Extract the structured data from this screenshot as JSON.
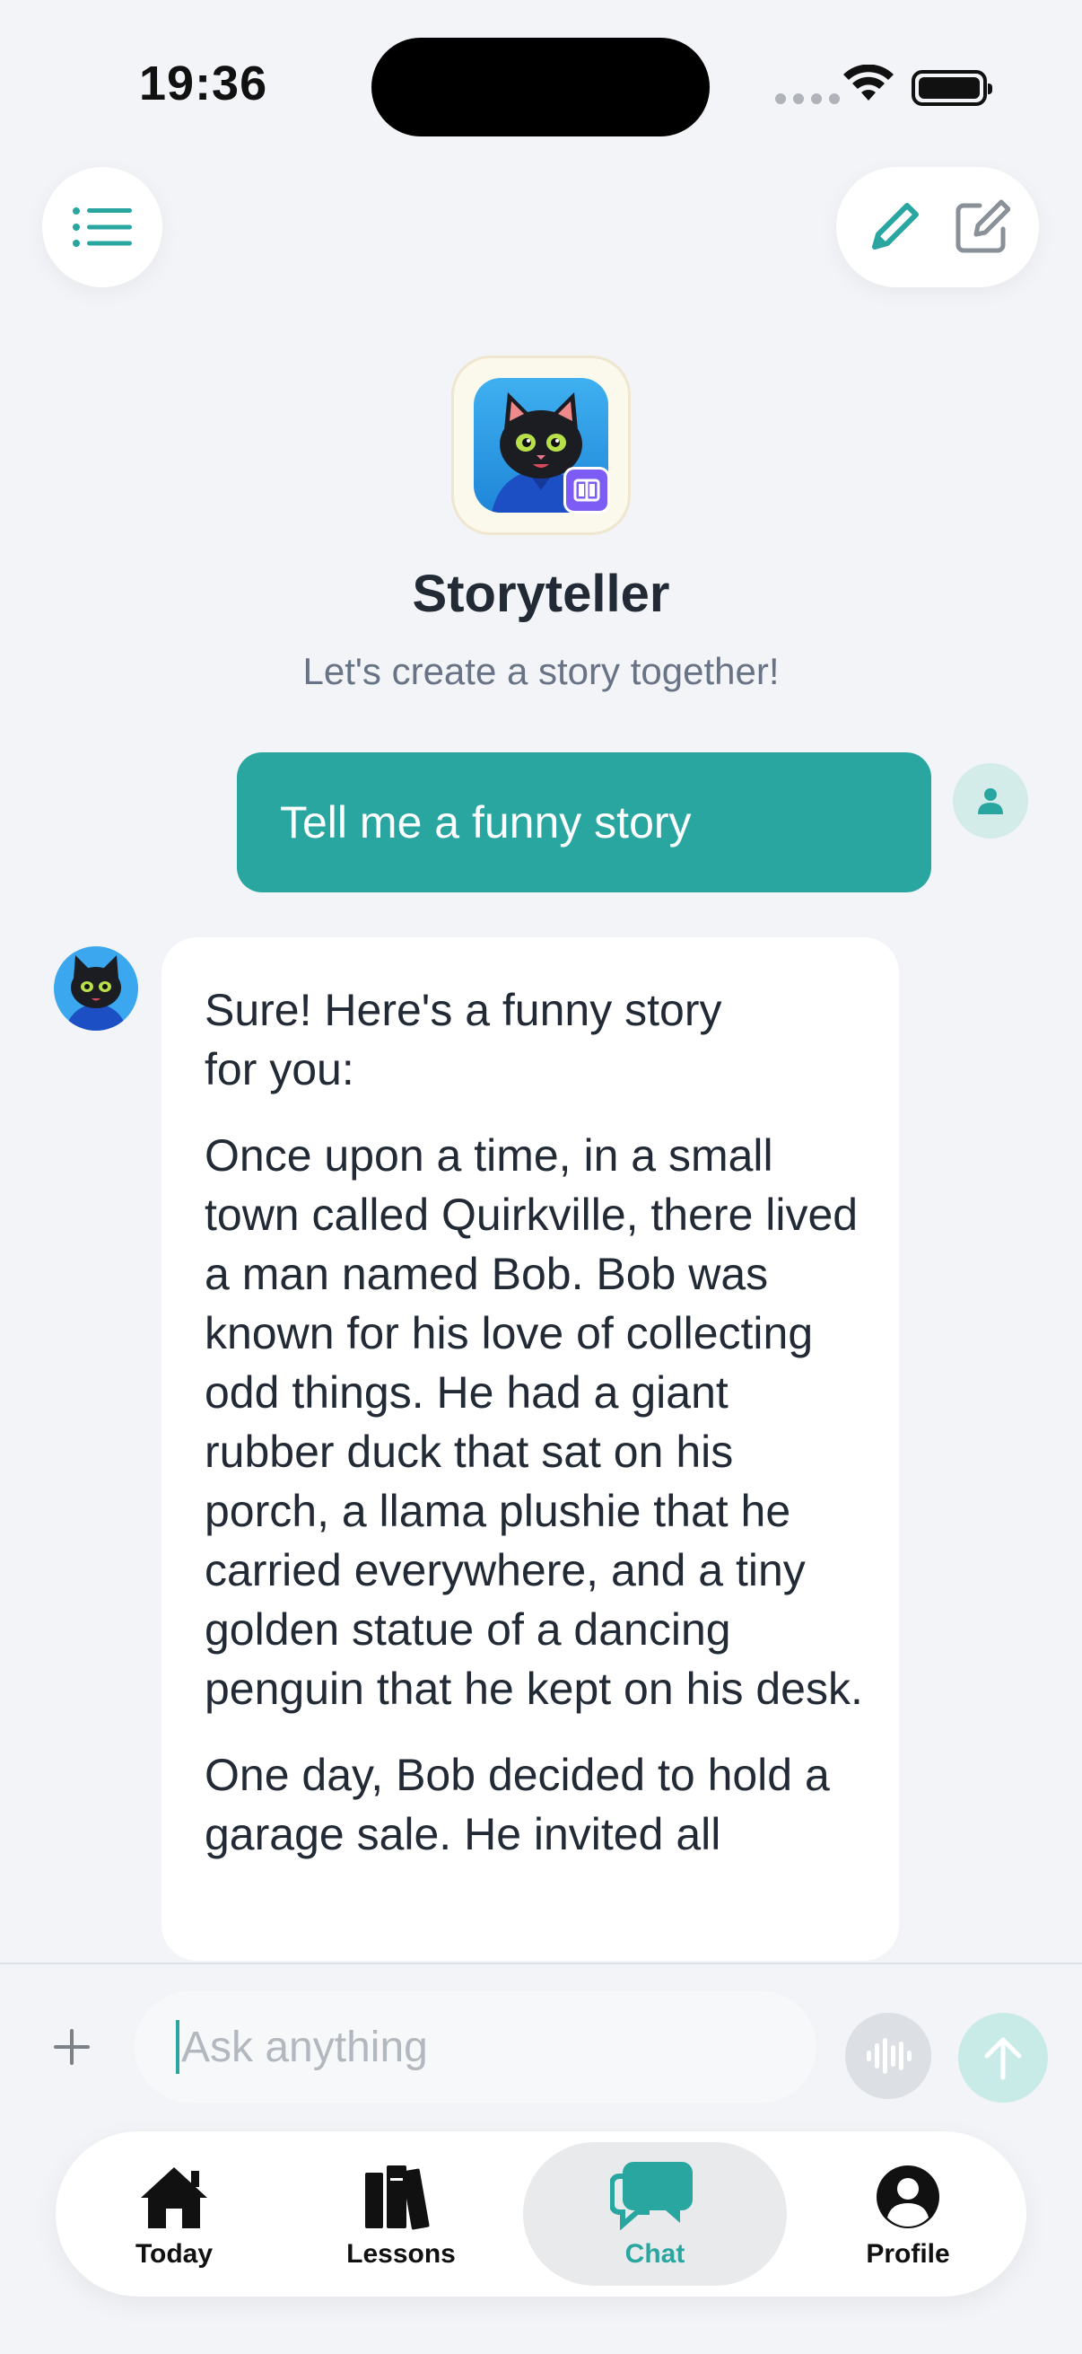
{
  "status_bar": {
    "time": "19:36"
  },
  "header": {
    "title": "Storyteller",
    "subtitle": "Let's create a story together!"
  },
  "messages": {
    "user": "Tell me a funny story",
    "bot": [
      "Sure! Here's a funny story for you:",
      "Once upon a time, in a small town called Quirkville, there lived a man named Bob. Bob was known for his love of collecting odd things. He had a giant rubber duck that sat on his porch, a llama plushie that he carried everywhere, and a tiny golden statue of a dancing penguin that he kept on his desk.",
      "One day, Bob decided to hold a garage sale. He invited all"
    ]
  },
  "composer": {
    "placeholder": "Ask anything"
  },
  "tabs": [
    {
      "label": "Today",
      "icon": "home-icon"
    },
    {
      "label": "Lessons",
      "icon": "books-icon"
    },
    {
      "label": "Chat",
      "icon": "chat-bubbles-icon",
      "active": true
    },
    {
      "label": "Profile",
      "icon": "profile-icon"
    }
  ],
  "colors": {
    "accent": "#2aa6a1",
    "background": "#f2f4f7",
    "badge": "#7c5cf5"
  }
}
